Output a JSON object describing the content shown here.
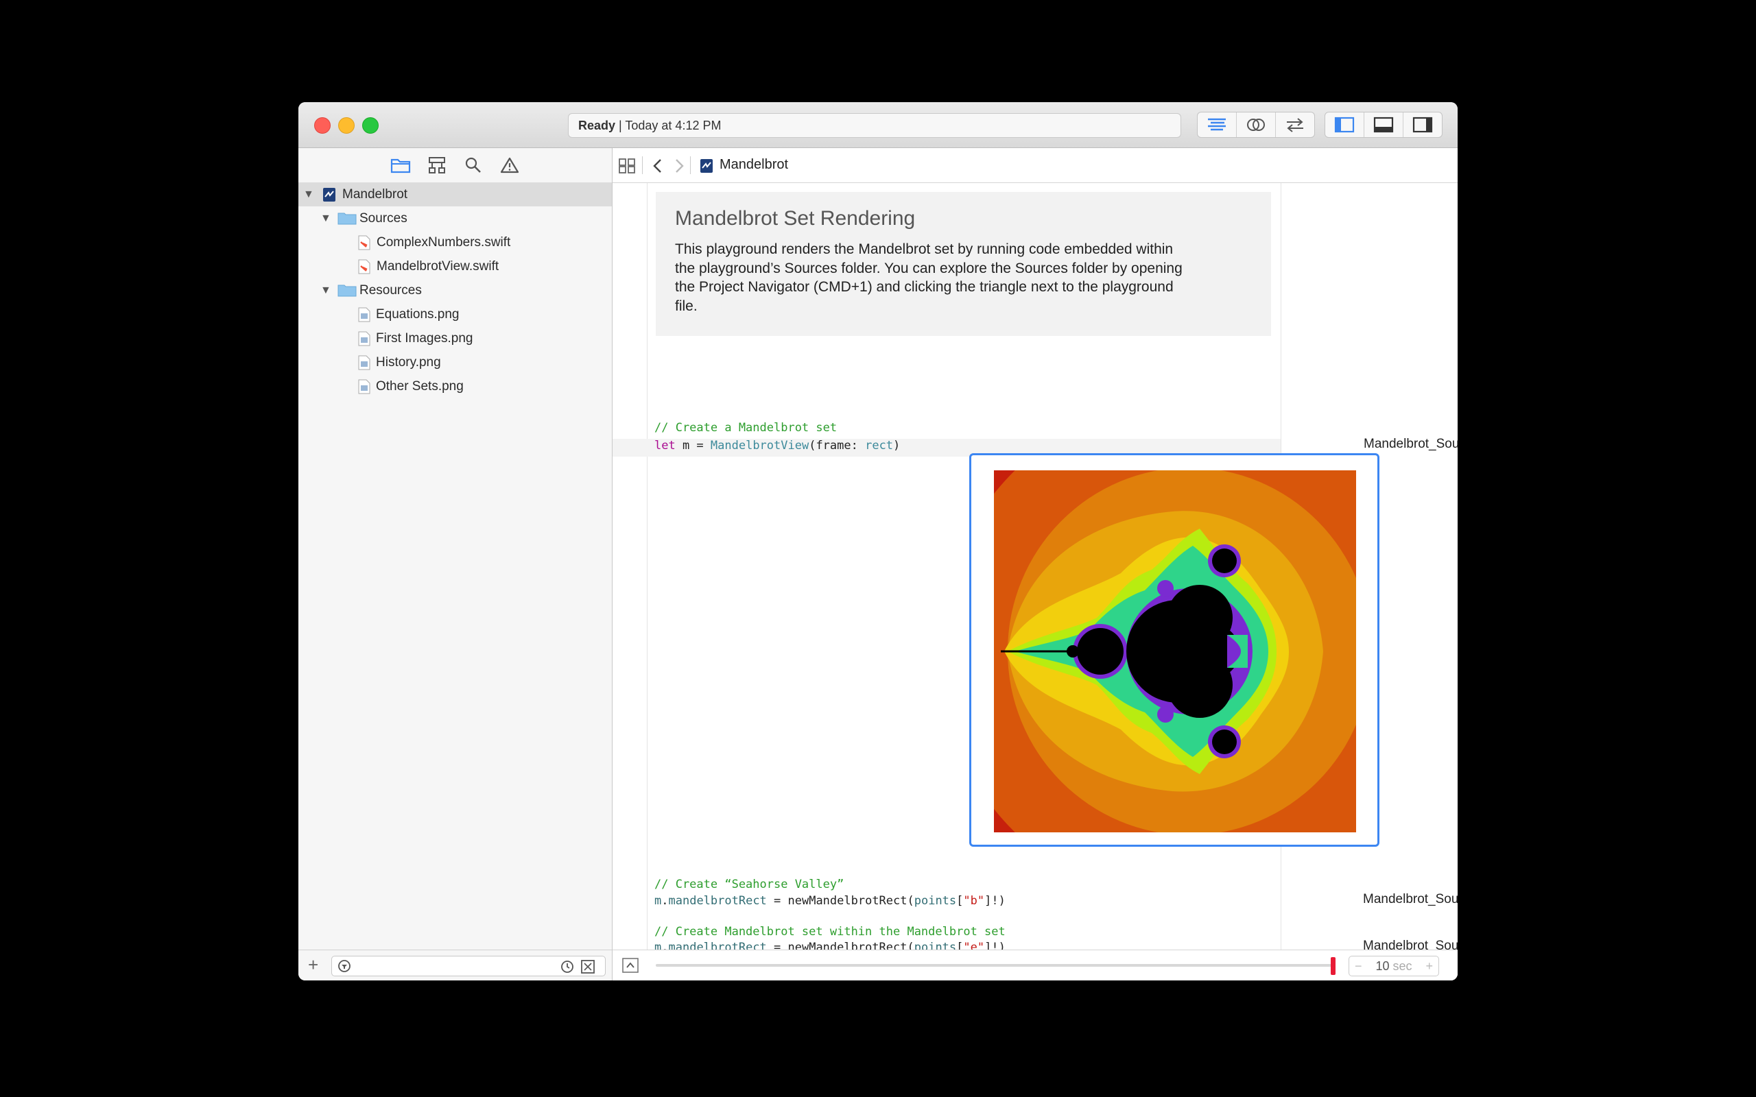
{
  "window": {
    "status_state": "Ready",
    "status_separator": " | ",
    "status_time": "Today at 4:12 PM"
  },
  "toolbar": {
    "editor_icons": [
      "standard-editor-icon",
      "assistant-editor-icon",
      "version-editor-icon"
    ],
    "panel_icons": [
      "navigator-panel-icon",
      "debug-panel-icon",
      "utilities-panel-icon"
    ]
  },
  "navigator": {
    "tabs": [
      "folder-icon",
      "hierarchy-icon",
      "search-icon",
      "warning-icon"
    ],
    "tree": [
      {
        "label": "Mandelbrot",
        "kind": "playground",
        "expanded": true
      },
      {
        "label": "Sources",
        "kind": "folder",
        "expanded": true
      },
      {
        "label": "ComplexNumbers.swift",
        "kind": "swift"
      },
      {
        "label": "MandelbrotView.swift",
        "kind": "swift"
      },
      {
        "label": "Resources",
        "kind": "folder",
        "expanded": true
      },
      {
        "label": "Equations.png",
        "kind": "image"
      },
      {
        "label": "First Images.png",
        "kind": "image"
      },
      {
        "label": "History.png",
        "kind": "image"
      },
      {
        "label": "Other Sets.png",
        "kind": "image"
      }
    ],
    "footer_add": "+"
  },
  "jumpbar": {
    "file": "Mandelbrot"
  },
  "doc": {
    "title": "Mandelbrot Set Rendering",
    "lines": [
      "This playground renders the Mandelbrot set by running code embedded within",
      "the playground’s Sources folder. You can explore the Sources folder by opening",
      "the Project Navigator (CMD+1) and clicking the triangle next to the playground",
      "file."
    ]
  },
  "code": {
    "c1": "// Create a Mandelbrot set",
    "l1_kw": "let",
    "l1_a": " m = ",
    "l1_type": "MandelbrotView",
    "l1_b": "(frame: ",
    "l1_arg": "rect",
    "l1_c": ")",
    "c2": "// Create “Seahorse Valley”",
    "c3": "// Create Mandelbrot set within the Mandelbrot set",
    "s_m": "m",
    "s_dot": ".",
    "s_prop": "mandelbrotRect",
    "s_eq": " = newMandelbrotRect(",
    "s_pts": "points",
    "s_open": "[",
    "k2": "\"b\"",
    "k3": "\"e\"",
    "s_close": "]!)"
  },
  "results": {
    "r1": "Mandelbrot_Source…",
    "r2": "Mandelbrot_Sources.M…",
    "r3": "Mandelbrot_Sources.M…"
  },
  "timeline": {
    "minus": "−",
    "value": "10",
    "unit": " sec",
    "plus": "+"
  },
  "colors": {
    "accent": "#3c86f2",
    "slider_thumb": "#e81b36",
    "comment": "#2e9e2e",
    "keyword": "#aa0d91",
    "type": "#3d8a9b"
  }
}
